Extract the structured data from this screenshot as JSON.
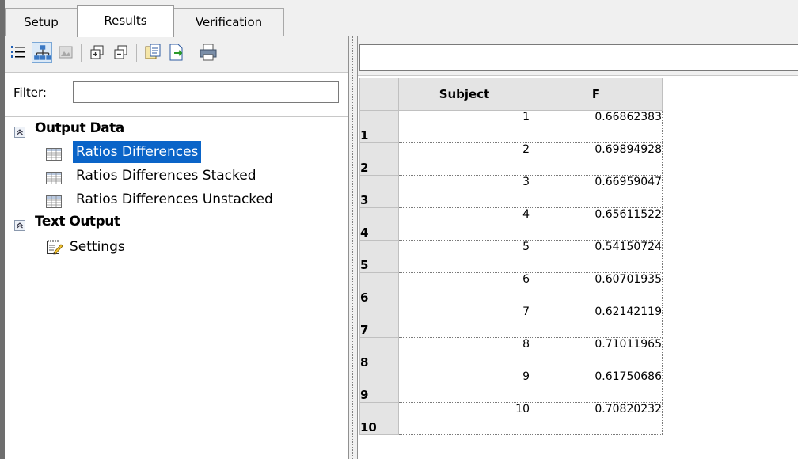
{
  "tabs": [
    {
      "label": "Setup",
      "active": false
    },
    {
      "label": "Results",
      "active": true
    },
    {
      "label": "Verification",
      "active": false
    }
  ],
  "toolbar": {
    "buttons": [
      {
        "icon": "list-view-icon",
        "pressed": false
      },
      {
        "icon": "tree-view-icon",
        "pressed": true
      },
      {
        "icon": "image-icon",
        "pressed": false
      },
      {
        "icon": "expand-all-icon",
        "pressed": false
      },
      {
        "icon": "collapse-all-icon",
        "pressed": false
      },
      {
        "icon": "copy-icon",
        "pressed": false
      },
      {
        "icon": "export-icon",
        "pressed": false
      },
      {
        "icon": "print-icon",
        "pressed": false
      }
    ]
  },
  "filter": {
    "label": "Filter:",
    "value": ""
  },
  "tree": {
    "groups": [
      {
        "label": "Output Data",
        "icon": "collapse-up-icon",
        "items": [
          {
            "label": "Ratios Differences",
            "icon": "table-icon",
            "selected": true
          },
          {
            "label": "Ratios Differences Stacked",
            "icon": "table-icon",
            "selected": false
          },
          {
            "label": "Ratios Differences Unstacked",
            "icon": "table-icon",
            "selected": false
          }
        ]
      },
      {
        "label": "Text Output",
        "icon": "collapse-up-icon",
        "items": [
          {
            "label": "Settings",
            "icon": "notepad-icon",
            "selected": false
          }
        ]
      }
    ]
  },
  "grid": {
    "columns": [
      "Subject",
      "F"
    ],
    "rows": [
      {
        "row": "1",
        "subject": "1",
        "f": "0.66862383"
      },
      {
        "row": "2",
        "subject": "2",
        "f": "0.69894928"
      },
      {
        "row": "3",
        "subject": "3",
        "f": "0.66959047"
      },
      {
        "row": "4",
        "subject": "4",
        "f": "0.65611522"
      },
      {
        "row": "5",
        "subject": "5",
        "f": "0.54150724"
      },
      {
        "row": "6",
        "subject": "6",
        "f": "0.60701935"
      },
      {
        "row": "7",
        "subject": "7",
        "f": "0.62142119"
      },
      {
        "row": "8",
        "subject": "8",
        "f": "0.71011965"
      },
      {
        "row": "9",
        "subject": "9",
        "f": "0.61750686"
      },
      {
        "row": "10",
        "subject": "10",
        "f": "0.70820232"
      }
    ]
  },
  "colors": {
    "selection": "#0a64c8",
    "header_bg": "#e4e4e4",
    "chrome": "#f0f0f0"
  }
}
